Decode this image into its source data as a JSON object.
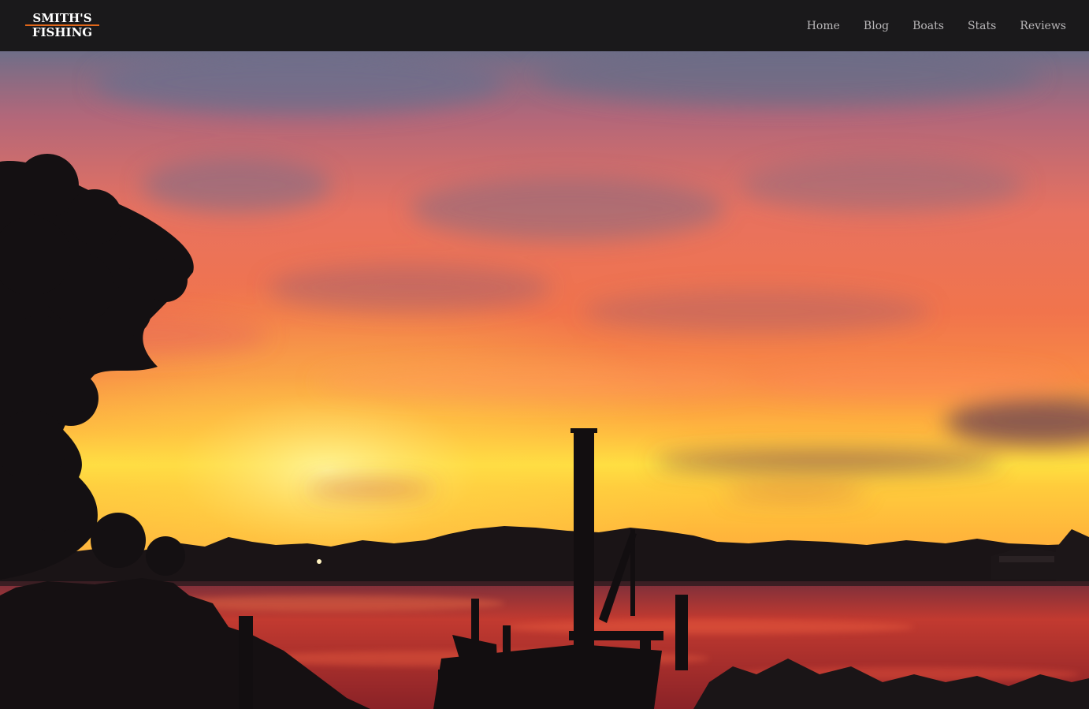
{
  "brand": {
    "line1": "SMITH'S",
    "line2": "FISHING",
    "accent_color": "#e0661a"
  },
  "nav": {
    "items": [
      {
        "label": "Home"
      },
      {
        "label": "Blog"
      },
      {
        "label": "Boats"
      },
      {
        "label": "Stats"
      },
      {
        "label": "Reviews"
      }
    ]
  },
  "hero": {
    "image": "sunset-over-river-with-dock",
    "colors": {
      "sky_top": "#6d6f8a",
      "sky_mid": "#e8725a",
      "horizon": "#ffd23a",
      "water": "#b4322e",
      "silhouette": "#141012"
    }
  }
}
